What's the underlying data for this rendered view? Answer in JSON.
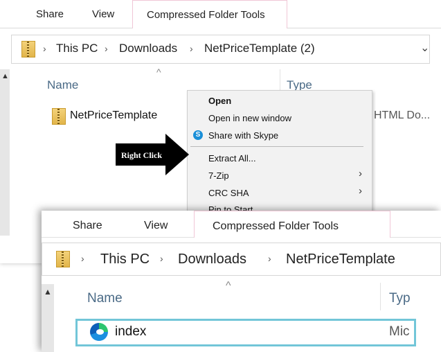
{
  "back_window": {
    "tabs": [
      "Share",
      "View"
    ],
    "active_tab": "Compressed Folder Tools",
    "breadcrumb": [
      "This PC",
      "Downloads",
      "NetPriceTemplate (2)"
    ],
    "columns": {
      "name": "Name",
      "type": "Type"
    },
    "file": {
      "name": "NetPriceTemplate",
      "type": "HTML Do..."
    }
  },
  "context_menu": {
    "items": [
      {
        "label": "Open"
      },
      {
        "label": "Open in new window"
      },
      {
        "label": "Share with Skype"
      },
      {
        "label": "Extract All..."
      },
      {
        "label": "7-Zip"
      },
      {
        "label": "CRC SHA"
      },
      {
        "label": "Pin to Start"
      }
    ]
  },
  "callout": {
    "label": "Right Click"
  },
  "front_window": {
    "tabs": [
      "Share",
      "View"
    ],
    "active_tab": "Compressed Folder Tools",
    "breadcrumb": [
      "This PC",
      "Downloads",
      "NetPriceTemplate"
    ],
    "columns": {
      "name": "Name",
      "type": "Typ"
    },
    "file": {
      "name": "index",
      "type": "Mic"
    }
  },
  "colors": {
    "highlight_border": "#72c6d8",
    "callout_bg": "#000000",
    "skype_blue": "#1a8fd8"
  }
}
